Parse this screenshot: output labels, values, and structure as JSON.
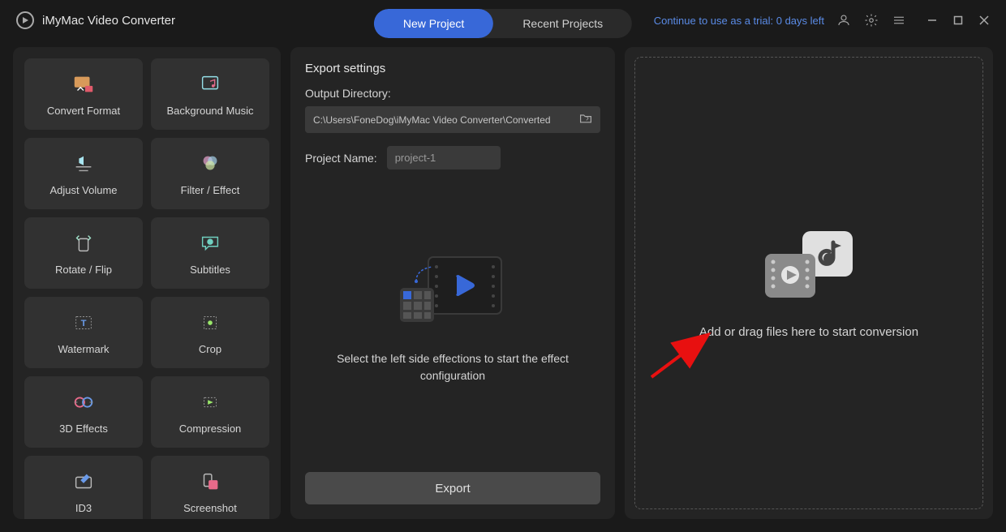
{
  "app": {
    "title": "iMyMac Video Converter"
  },
  "tabs": {
    "new": "New Project",
    "recent": "Recent Projects"
  },
  "header": {
    "trial": "Continue to use as a trial: 0 days left"
  },
  "sidebar": {
    "items": [
      {
        "label": "Convert Format"
      },
      {
        "label": "Background Music"
      },
      {
        "label": "Adjust Volume"
      },
      {
        "label": "Filter / Effect"
      },
      {
        "label": "Rotate / Flip"
      },
      {
        "label": "Subtitles"
      },
      {
        "label": "Watermark"
      },
      {
        "label": "Crop"
      },
      {
        "label": "3D Effects"
      },
      {
        "label": "Compression"
      },
      {
        "label": "ID3"
      },
      {
        "label": "Screenshot"
      }
    ]
  },
  "export": {
    "title": "Export settings",
    "dir_label": "Output Directory:",
    "dir_value": "C:\\Users\\FoneDog\\iMyMac Video Converter\\Converted",
    "name_label": "Project Name:",
    "name_value": "project-1",
    "hint": "Select the left side effections to start the effect configuration",
    "button": "Export"
  },
  "drop": {
    "text": "Add or drag files here to start conversion"
  }
}
